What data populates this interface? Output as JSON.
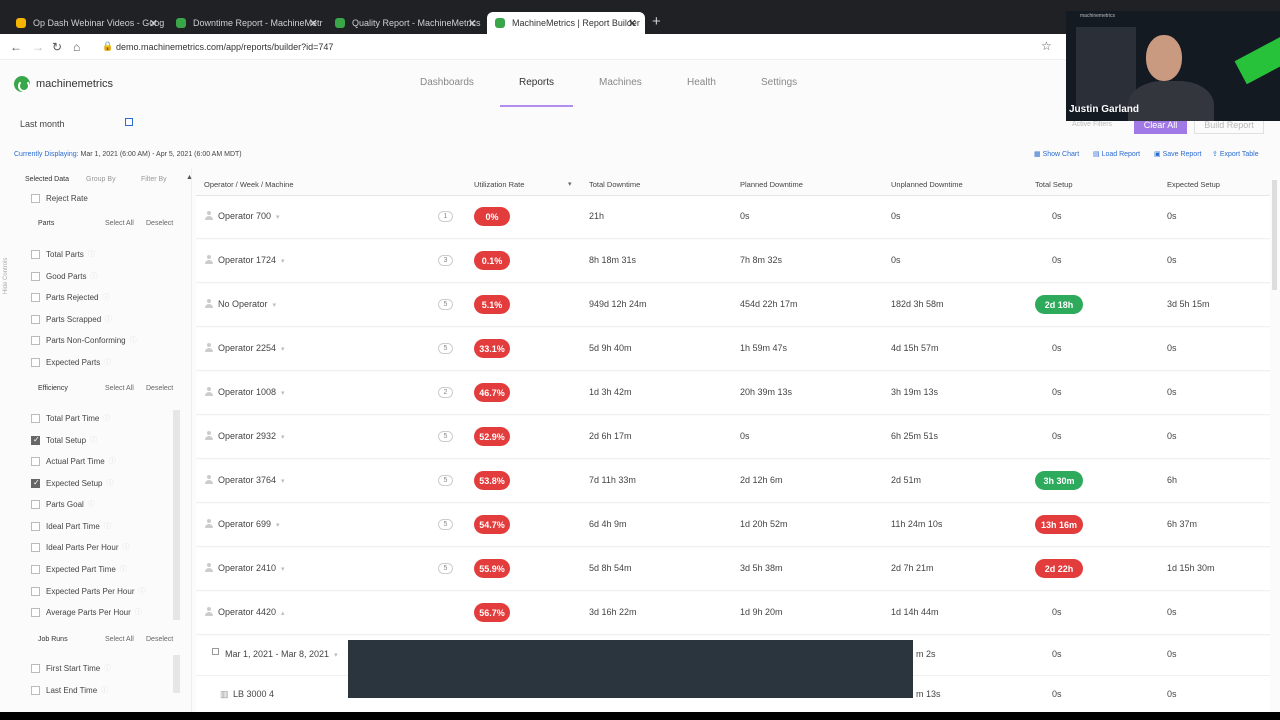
{
  "browser": {
    "tabs": [
      {
        "title": "Op Dash Webinar Videos - Goog",
        "favicon_color": "#f5b400"
      },
      {
        "title": "Downtime Report - MachineMetr",
        "favicon_color": "#3aa64a"
      },
      {
        "title": "Quality Report - MachineMetrics",
        "favicon_color": "#3aa64a"
      },
      {
        "title": "MachineMetrics | Report Builder",
        "favicon_color": "#3aa64a"
      }
    ],
    "new_tab": "+",
    "close": "✕",
    "url": "demo.machinemetrics.com/app/reports/builder?id=747"
  },
  "app": {
    "logo": "machinemetrics",
    "nav": [
      "Dashboards",
      "Reports",
      "Machines",
      "Health",
      "Settings"
    ],
    "active_nav": "Reports",
    "range": "Last month",
    "active_filters": "Active Filters",
    "clear_all": "Clear All",
    "build_report": "Build Report",
    "displaying_label": "Currently Displaying:",
    "displaying_value": "Mar 1, 2021 (6:00 AM) - Apr 5, 2021 (6:00 AM MDT)",
    "actions": [
      "Show Chart",
      "Load Report",
      "Save Report",
      "Export Table"
    ]
  },
  "sidebar": {
    "vertical": "Hide Controls",
    "tabs": [
      "Selected Data",
      "Group By",
      "Filter By"
    ],
    "select_all": "Select All",
    "deselect": "Deselect",
    "top_item": "Reject Rate",
    "sections": [
      {
        "title": "Parts",
        "items": [
          {
            "label": "Total Parts",
            "checked": false
          },
          {
            "label": "Good Parts",
            "checked": false
          },
          {
            "label": "Parts Rejected",
            "checked": false
          },
          {
            "label": "Parts Scrapped",
            "checked": false
          },
          {
            "label": "Parts Non-Conforming",
            "checked": false
          },
          {
            "label": "Expected Parts",
            "checked": false
          }
        ]
      },
      {
        "title": "Efficiency",
        "items": [
          {
            "label": "Total Part Time",
            "checked": false
          },
          {
            "label": "Total Setup",
            "checked": true
          },
          {
            "label": "Actual Part Time",
            "checked": false
          },
          {
            "label": "Expected Setup",
            "checked": true
          },
          {
            "label": "Parts Goal",
            "checked": false
          },
          {
            "label": "Ideal Part Time",
            "checked": false
          },
          {
            "label": "Ideal Parts Per Hour",
            "checked": false
          },
          {
            "label": "Expected Part Time",
            "checked": false
          },
          {
            "label": "Expected Parts Per Hour",
            "checked": false
          },
          {
            "label": "Average Parts Per Hour",
            "checked": false
          }
        ]
      },
      {
        "title": "Job Runs",
        "items": [
          {
            "label": "First Start Time",
            "checked": false
          },
          {
            "label": "Last End Time",
            "checked": false
          }
        ]
      }
    ]
  },
  "table": {
    "headers": [
      "Operator / Week / Machine",
      "Utilization Rate",
      "Total Downtime",
      "Planned Downtime",
      "Unplanned Downtime",
      "Total Setup",
      "Expected Setup"
    ],
    "rows": [
      {
        "name": "Operator 700",
        "count": "1",
        "util": "0%",
        "total_dt": "21h",
        "planned": "0s",
        "unplanned": "0s",
        "setup": "0s",
        "setup_flag": "",
        "expected": "0s"
      },
      {
        "name": "Operator 1724",
        "count": "3",
        "util": "0.1%",
        "total_dt": "8h 18m 31s",
        "planned": "7h 8m 32s",
        "unplanned": "0s",
        "setup": "0s",
        "setup_flag": "",
        "expected": "0s"
      },
      {
        "name": "No Operator",
        "count": "5",
        "util": "5.1%",
        "total_dt": "949d 12h 24m",
        "planned": "454d 22h 17m",
        "unplanned": "182d 3h 58m",
        "setup": "2d 18h",
        "setup_flag": "green",
        "expected": "3d 5h 15m"
      },
      {
        "name": "Operator 2254",
        "count": "5",
        "util": "33.1%",
        "total_dt": "5d 9h 40m",
        "planned": "1h 59m 47s",
        "unplanned": "4d 15h 57m",
        "setup": "0s",
        "setup_flag": "",
        "expected": "0s"
      },
      {
        "name": "Operator 1008",
        "count": "2",
        "util": "46.7%",
        "total_dt": "1d 3h 42m",
        "planned": "20h 39m 13s",
        "unplanned": "3h 19m 13s",
        "setup": "0s",
        "setup_flag": "",
        "expected": "0s"
      },
      {
        "name": "Operator 2932",
        "count": "5",
        "util": "52.9%",
        "total_dt": "2d 6h 17m",
        "planned": "0s",
        "unplanned": "6h 25m 51s",
        "setup": "0s",
        "setup_flag": "",
        "expected": "0s"
      },
      {
        "name": "Operator 3764",
        "count": "5",
        "util": "53.8%",
        "total_dt": "7d 11h 33m",
        "planned": "2d 12h 6m",
        "unplanned": "2d 51m",
        "setup": "3h 30m",
        "setup_flag": "green",
        "expected": "6h"
      },
      {
        "name": "Operator 699",
        "count": "5",
        "util": "54.7%",
        "total_dt": "6d 4h 9m",
        "planned": "1d 20h 52m",
        "unplanned": "11h 24m 10s",
        "setup": "13h 16m",
        "setup_flag": "red",
        "expected": "6h 37m"
      },
      {
        "name": "Operator 2410",
        "count": "5",
        "util": "55.9%",
        "total_dt": "5d 8h 54m",
        "planned": "3d 5h 38m",
        "unplanned": "2d 7h 21m",
        "setup": "2d 22h",
        "setup_flag": "red",
        "expected": "1d 15h 30m"
      },
      {
        "name": "Operator 4420",
        "count": "",
        "util": "56.7%",
        "total_dt": "3d 16h 22m",
        "planned": "1d 9h 20m",
        "unplanned": "1d 14h 44m",
        "setup": "0s",
        "setup_flag": "",
        "expected": "0s"
      }
    ],
    "subrows": [
      {
        "label": "Mar 1, 2021 - Mar 8, 2021",
        "unplanned": "m 2s",
        "setup": "0s",
        "expected": "0s"
      },
      {
        "label": "LB 3000 4",
        "unplanned": "m 13s",
        "setup": "0s",
        "expected": "0s"
      }
    ]
  },
  "webcam": {
    "name": "Justin Garland",
    "logo": "machinemetrics"
  }
}
